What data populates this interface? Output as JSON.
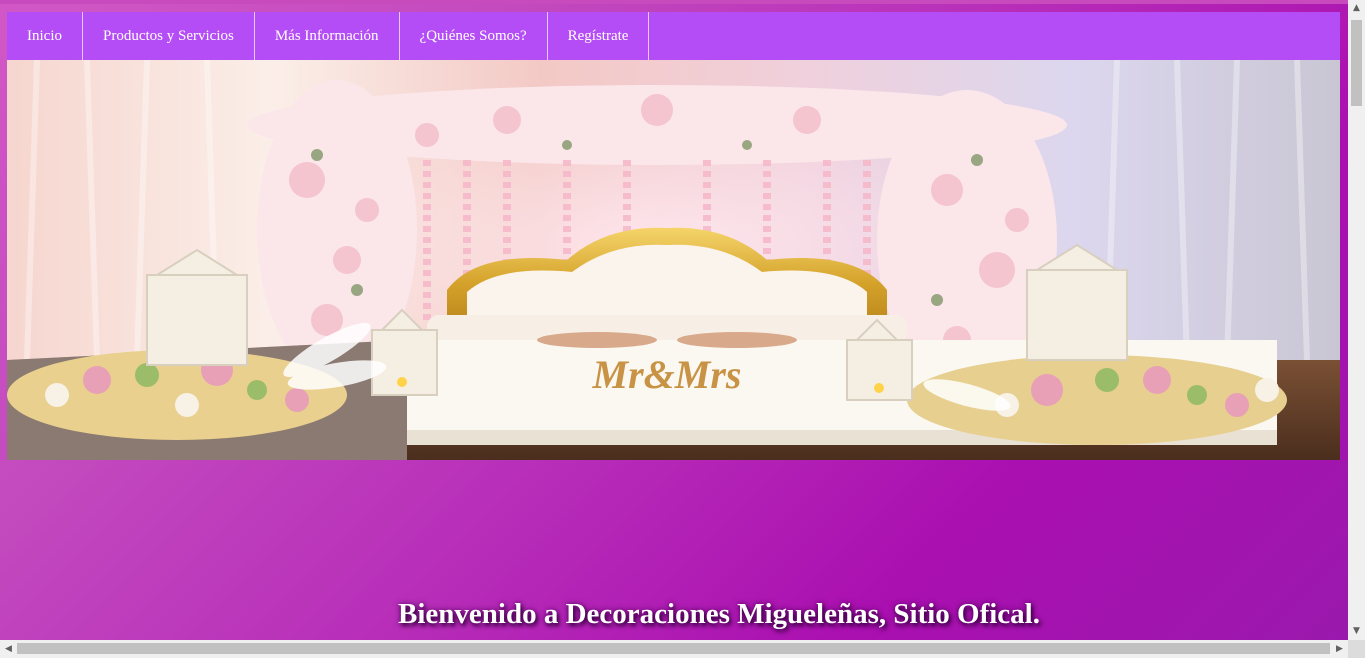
{
  "nav": {
    "items": [
      {
        "label": "Inicio"
      },
      {
        "label": "Productos y Servicios"
      },
      {
        "label": "Más Información"
      },
      {
        "label": "¿Quiénes Somos?"
      },
      {
        "label": "Regístrate"
      }
    ]
  },
  "hero": {
    "image_description": "wedding-stage-decoration",
    "sign_text": "Mr&Mrs"
  },
  "welcome": {
    "text": "Bienvenido a Decoraciones Migueleñas, Sitio Ofical."
  },
  "colors": {
    "nav_bg": "#b44df5",
    "page_gradient_start": "#d257c6",
    "page_gradient_end": "#9a19ad",
    "text": "#ffffff"
  },
  "scrollbars": {
    "up_icon": "chevron-up-icon",
    "down_icon": "chevron-down-icon",
    "left_icon": "chevron-left-icon",
    "right_icon": "chevron-right-icon"
  }
}
